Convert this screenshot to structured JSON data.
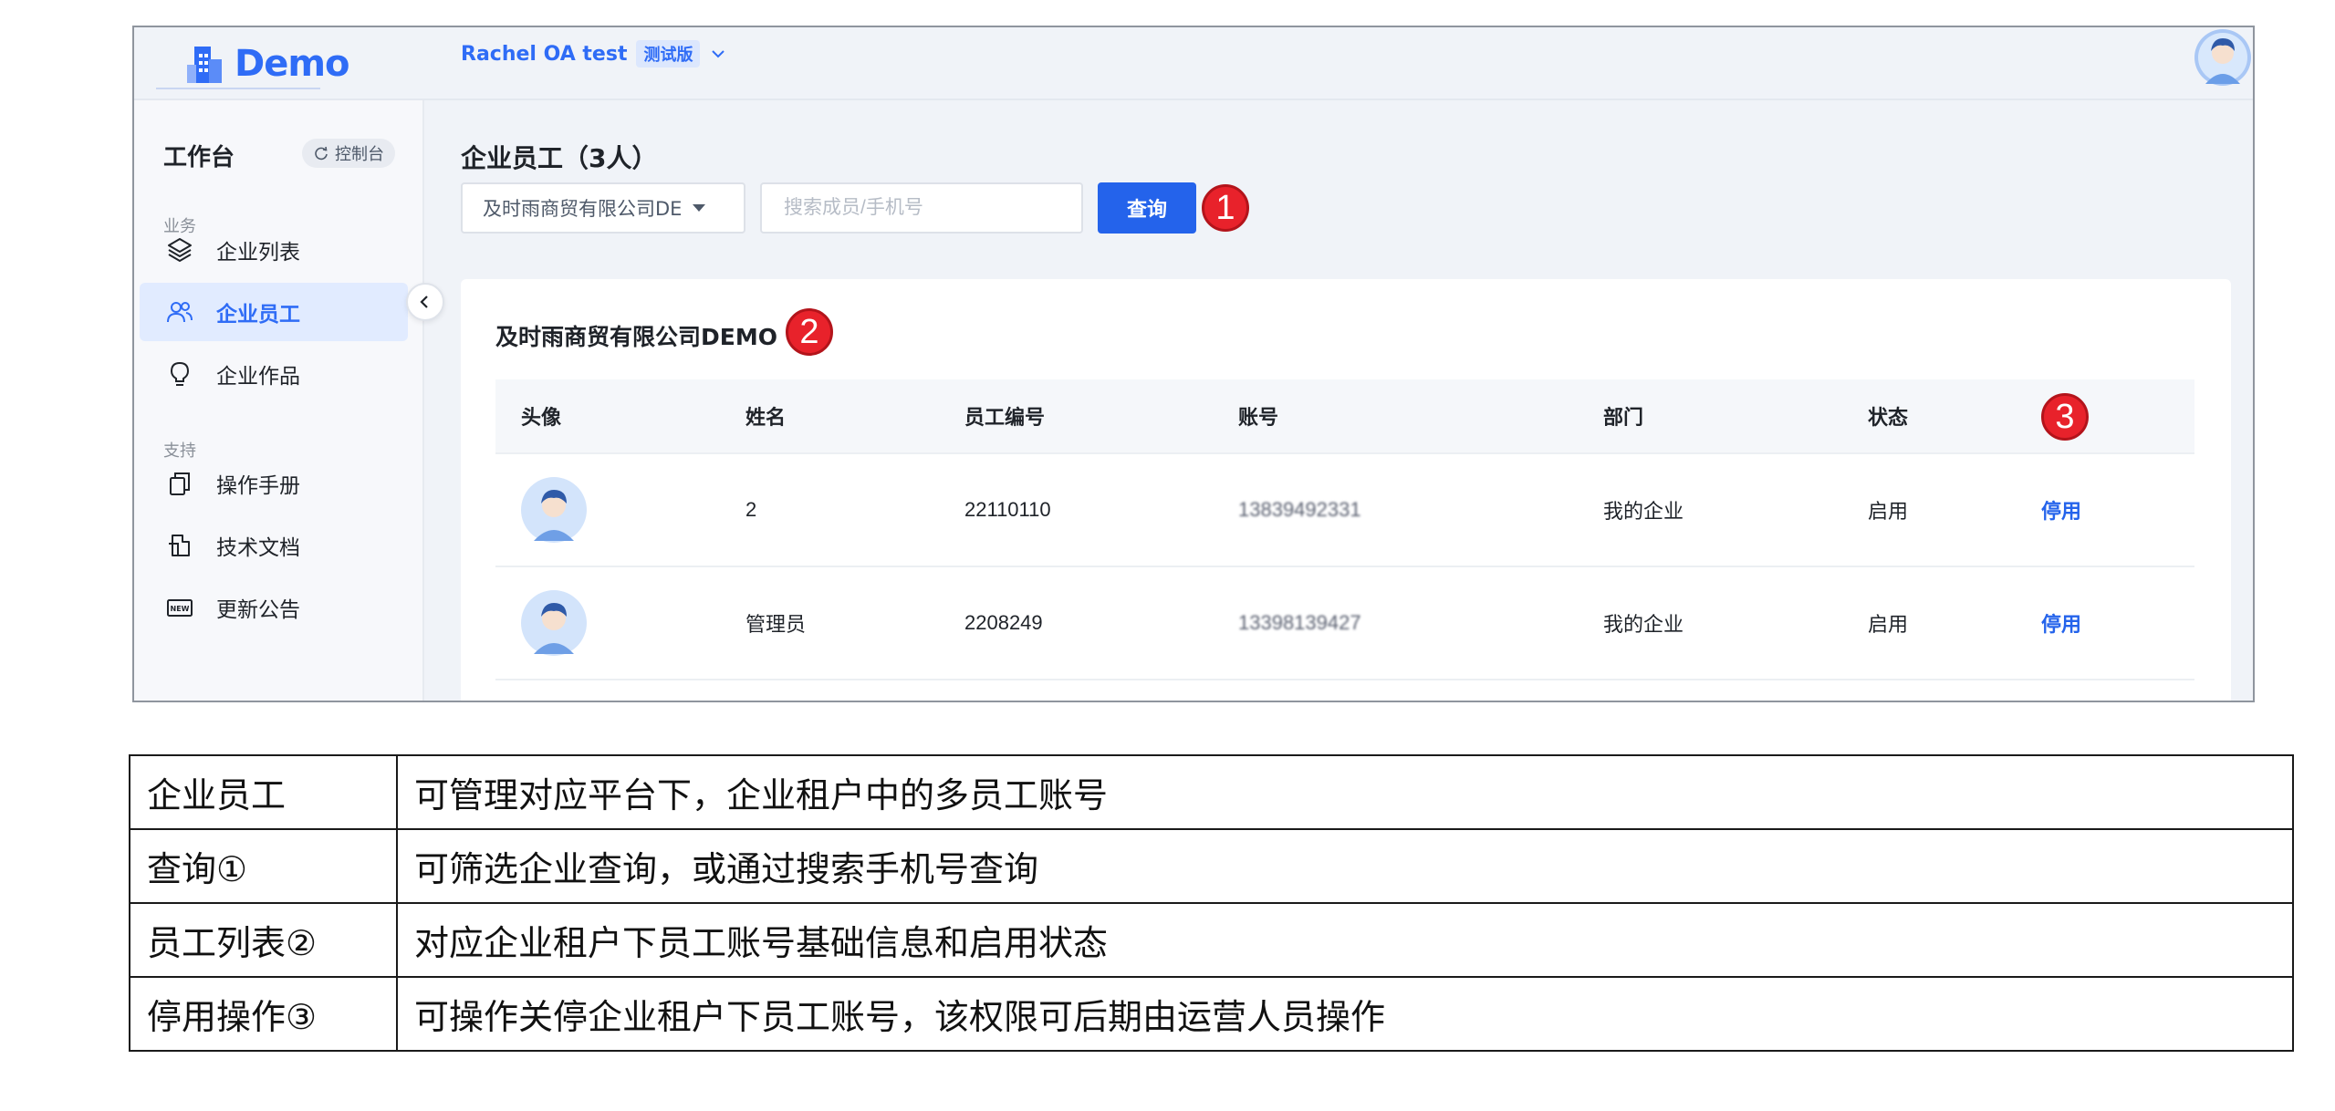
{
  "app": {
    "logo_text": "Demo",
    "org_name": "Rachel OA test",
    "org_badge": "测试版",
    "brand_color": "#2f6cf6",
    "icons": [
      "building-logo-icon",
      "chevron-down-icon",
      "user-avatar-icon"
    ]
  },
  "sidebar": {
    "title": "工作台",
    "console_label": "控制台",
    "group_business": "业务",
    "group_support": "支持",
    "items": [
      {
        "label": "企业列表",
        "icon": "layers-icon",
        "active": false
      },
      {
        "label": "企业员工",
        "icon": "users-icon",
        "active": true
      },
      {
        "label": "企业作品",
        "icon": "bulb-icon",
        "active": false
      },
      {
        "label": "操作手册",
        "icon": "copy-icon",
        "active": false
      },
      {
        "label": "技术文档",
        "icon": "document-icon",
        "active": false
      },
      {
        "label": "更新公告",
        "icon": "new-badge-icon",
        "active": false
      }
    ]
  },
  "main": {
    "page_title": "企业员工（3人）",
    "company_select_value": "及时雨商贸有限公司DE",
    "search_placeholder": "搜索成员/手机号",
    "query_label": "查询",
    "card_title": "及时雨商贸有限公司DEMO",
    "markers": [
      "1",
      "2",
      "3"
    ],
    "marker_color": "#e8222b",
    "columns": [
      "头像",
      "姓名",
      "员工编号",
      "账号",
      "部门",
      "状态"
    ],
    "rows": [
      {
        "name": "2",
        "emp_no": "22110110",
        "account": "13839492331",
        "dept": "我的企业",
        "status": "启用",
        "action": "停用"
      },
      {
        "name": "管理员",
        "emp_no": "2208249",
        "account": "13398139427",
        "dept": "我的企业",
        "status": "启用",
        "action": "停用"
      }
    ]
  },
  "description": [
    {
      "key": "企业员工",
      "value": "可管理对应平台下，企业租户中的多员工账号"
    },
    {
      "key": "查询①",
      "value": "可筛选企业查询，或通过搜索手机号查询"
    },
    {
      "key": "员工列表②",
      "value": "对应企业租户下员工账号基础信息和启用状态"
    },
    {
      "key": "停用操作③",
      "value": "可操作关停企业租户下员工账号，该权限可后期由运营人员操作"
    }
  ]
}
